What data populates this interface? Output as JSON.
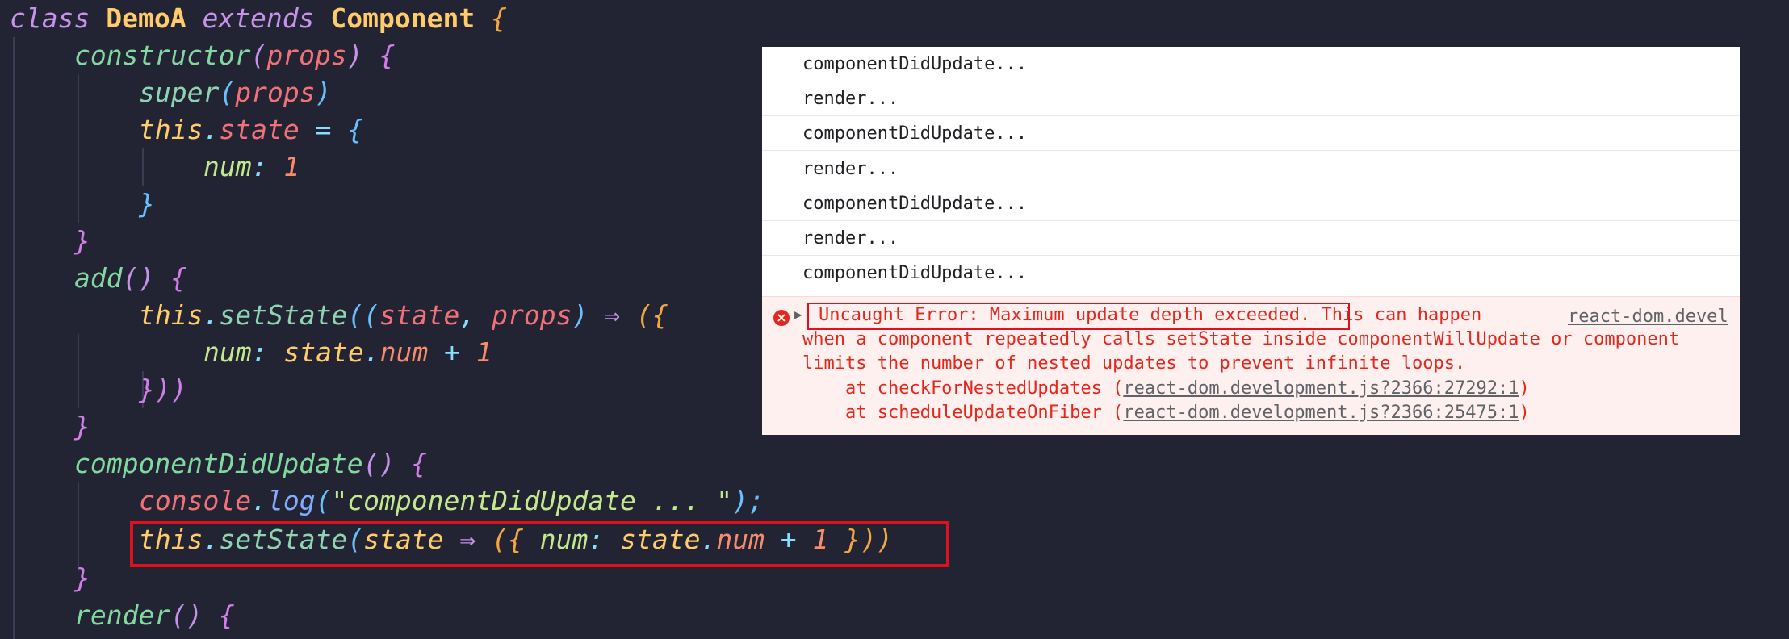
{
  "code": {
    "lines": [
      {
        "class_kw": "class",
        "class_name": "DemoA",
        "extends_kw": "extends",
        "base": "Component",
        "brace": "{"
      },
      {
        "name": "constructor",
        "open": "(",
        "param": "props",
        "close": ")",
        "brace": "{"
      },
      {
        "name": "super",
        "open": "(",
        "param": "props",
        "close": ")"
      },
      {
        "this": "this",
        "dot": ".",
        "prop": "state",
        "eq": " = ",
        "brace": "{"
      },
      {
        "key": "num",
        "colon": ": ",
        "value": "1"
      },
      {
        "brace": "}"
      },
      {
        "brace": "}"
      },
      {
        "name": "add",
        "parens": "()",
        "brace": "{"
      },
      {
        "this": "this",
        "dot": ".",
        "method": "setState",
        "open": "((",
        "p1": "state",
        "comma": ", ",
        "p2": "props",
        "close": ")",
        "arrow": " ⇒ ",
        "brace": "({"
      },
      {
        "key": "num",
        "colon": ": ",
        "obj": "state",
        "dot": ".",
        "prop": "num",
        "plus": " + ",
        "value": "1"
      },
      {
        "brace": "}))"
      },
      {
        "brace": "}"
      },
      {
        "name": "componentDidUpdate",
        "parens": "()",
        "brace": "{"
      },
      {
        "obj": "console",
        "dot": ".",
        "method": "log",
        "open": "(",
        "str": "\"componentDidUpdate ... \"",
        "close": ");"
      },
      {
        "this": "this",
        "dot": ".",
        "method": "setState",
        "open": "(",
        "p1": "state",
        "arrow": " ⇒ ",
        "brace_open": "({ ",
        "key": "num",
        "colon": ": ",
        "obj": "state",
        "dot2": ".",
        "prop": "num",
        "plus": " + ",
        "value": "1",
        "brace_close": " }))"
      },
      {
        "brace": "}"
      },
      {
        "name": "render",
        "parens": "()",
        "brace": "{"
      }
    ]
  },
  "console": {
    "logs": [
      "componentDidUpdate...",
      "render...",
      "componentDidUpdate...",
      "render...",
      "componentDidUpdate...",
      "render...",
      "componentDidUpdate..."
    ],
    "error": {
      "title": "Uncaught Error: Maximum update depth exceeded.",
      "title_rest": " This can happen",
      "source": "react-dom.devel",
      "line2": "when a component repeatedly calls setState inside componentWillUpdate or component",
      "line3": "limits the number of nested updates to prevent infinite loops.",
      "stack": [
        {
          "at": "    at checkForNestedUpdates (",
          "link": "react-dom.development.js?2366:27292:1",
          "end": ")"
        },
        {
          "at": "    at scheduleUpdateOnFiber (",
          "link": "react-dom.development.js?2366:25475:1",
          "end": ")"
        }
      ]
    }
  },
  "colors": {
    "editor_bg": "#222433",
    "highlight_border": "#e2101d",
    "error_text": "#e4271c",
    "error_bg": "#fff0f0"
  }
}
